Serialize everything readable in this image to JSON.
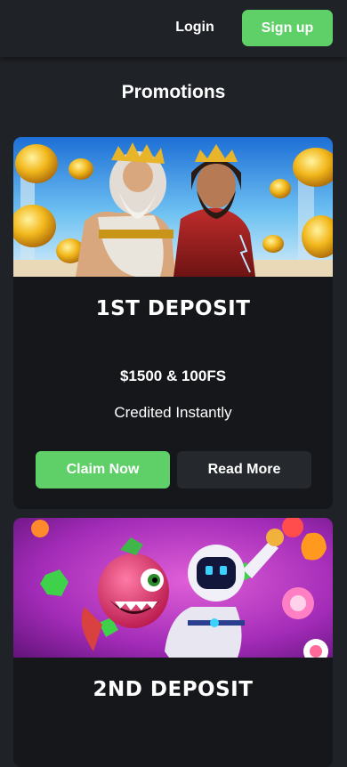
{
  "header": {
    "login_label": "Login",
    "signup_label": "Sign up"
  },
  "page": {
    "title": "Promotions"
  },
  "promotions": [
    {
      "heading": "1ST DEPOSIT",
      "bonus": "$1500 & 100FS",
      "subtext": "Credited Instantly",
      "claim_label": "Claim Now",
      "read_more_label": "Read More",
      "banner_art": "zeus-and-hades-slot-art"
    },
    {
      "heading": "2ND DEPOSIT",
      "banner_art": "candy-monster-and-space-robot-slot-art"
    }
  ],
  "colors": {
    "background": "#1f2226",
    "card": "#15171a",
    "accent_green": "#5fd068",
    "secondary_button": "#25282d",
    "text": "#ffffff"
  }
}
